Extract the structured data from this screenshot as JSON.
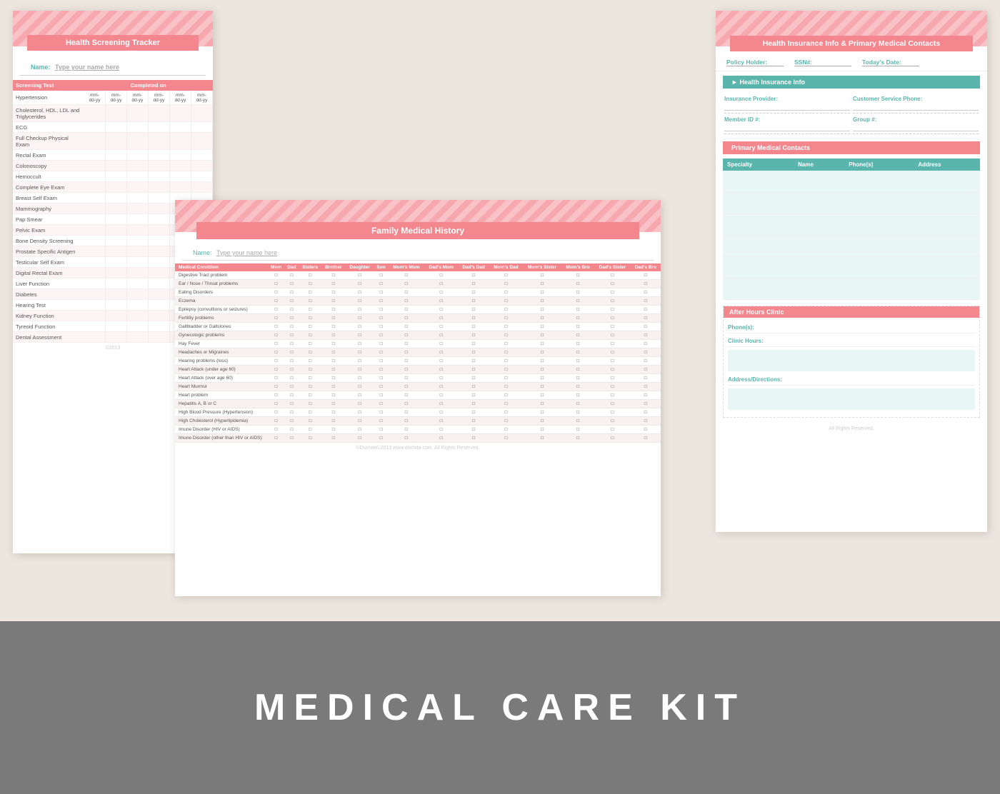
{
  "bottom_banner": {
    "text": "MEDICAL CARE KIT"
  },
  "screening_card": {
    "title": "Health Screening Tracker",
    "name_label": "Name:",
    "name_placeholder": "Type your name here",
    "table_headers": {
      "test": "Screening Test",
      "completed": "Completed on"
    },
    "date_placeholder": "mm-dd-yy",
    "tests": [
      "Hypertension",
      "Cholesterol, HDL, LDL and Triglycerides",
      "ECG",
      "Full Checkup Physical Exam",
      "Rectal Exam",
      "Colonoscopy",
      "Hemoccult",
      "Complete Eye Exam",
      "Breast Self Exam",
      "Mammography",
      "Pap Smear",
      "Pelvic Exam",
      "Bone Density Screening",
      "Prostate Specific Antigen",
      "Testicular Self Exam",
      "Digital Rectal Exam",
      "Liver Function",
      "Diabetes",
      "Hearing Test",
      "Kidney Function",
      "Tyreoid Function",
      "Dental Assessment"
    ]
  },
  "family_card": {
    "title": "Family Medical History",
    "name_label": "Name:",
    "name_placeholder": "Type your name here",
    "columns": [
      "Medical Condition",
      "Mom",
      "Dad",
      "Sisters",
      "Brother",
      "Daughter",
      "Son",
      "Mom's Mom",
      "Dad's Mom",
      "Dad's Dad",
      "Mom's Dad",
      "Mom's Sister",
      "Mom's Bro",
      "Dad's Sister",
      "Dad's Bro"
    ],
    "conditions": [
      "Digestive Tract problem",
      "Ear / Nose / Throat problems",
      "Eating Disorders",
      "Eczema",
      "Epilepsy (convultions or seizures)",
      "Fertility problems",
      "Gallbladder or Gallstones",
      "Gynecologic problems",
      "Hay Fever",
      "Headaches or Migraines",
      "Hearing problems (loss)",
      "Heart Attack (under age 60)",
      "Heart Attack (over age 60)",
      "Heart Murmur",
      "Heart problem",
      "Hepatitis A, B or C",
      "High Blood Pressure (Hypertension)",
      "High Cholesterol (Hyperlipidemia)",
      "Imune Disorder (HIV or AIDS)",
      "Imune Disorder (other than HIV or AIDS)"
    ]
  },
  "insurance_card": {
    "title": "Health Insurance Info & Primary Medical Contacts",
    "policy_holder_label": "Policy Holder:",
    "ssn_label": "SSN#:",
    "date_label": "Today's Date:",
    "health_insurance_section": "Health Insurance Info",
    "provider_label": "Insurance Provider:",
    "service_phone_label": "Customer Service Phone:",
    "member_id_label": "Member ID #:",
    "group_label": "Group #:",
    "contacts_section": "Primary Medical Contacts",
    "contacts_columns": [
      "Specialty",
      "Name",
      "Phone(s)",
      "Address"
    ],
    "after_hours_section": "After Hours Clinic",
    "phone_label": "Phone(s):",
    "clinic_hours_label": "Clinic Hours:",
    "address_label": "Address/Directions:"
  }
}
